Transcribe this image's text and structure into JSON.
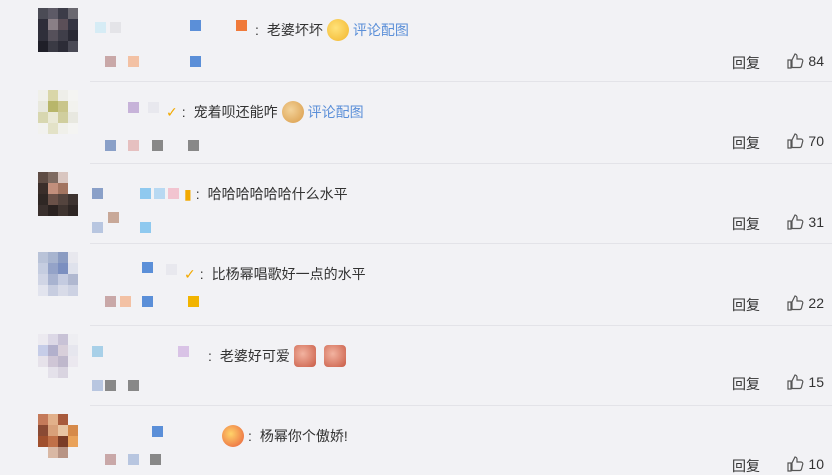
{
  "reply_label": "回复",
  "comments": [
    {
      "text": "老婆坏坏",
      "link": "评论配图",
      "likes": "84",
      "emoji": "smile"
    },
    {
      "text": "宠着呗还能咋",
      "link": "评论配图",
      "likes": "70",
      "emoji": "dog"
    },
    {
      "text": "哈哈哈哈哈哈什么水平",
      "link": "",
      "likes": "31",
      "emoji": ""
    },
    {
      "text": "比杨幂唱歌好一点的水平",
      "link": "",
      "likes": "22",
      "emoji": ""
    },
    {
      "text": "老婆好可爱",
      "link": "",
      "likes": "15",
      "emoji": "ghost"
    },
    {
      "text": "杨幂你个傲娇!",
      "link": "",
      "likes": "10",
      "emoji": ""
    }
  ],
  "colors": {
    "link": "#5b8fd8",
    "text": "#333333",
    "badge": "#f2a900"
  }
}
